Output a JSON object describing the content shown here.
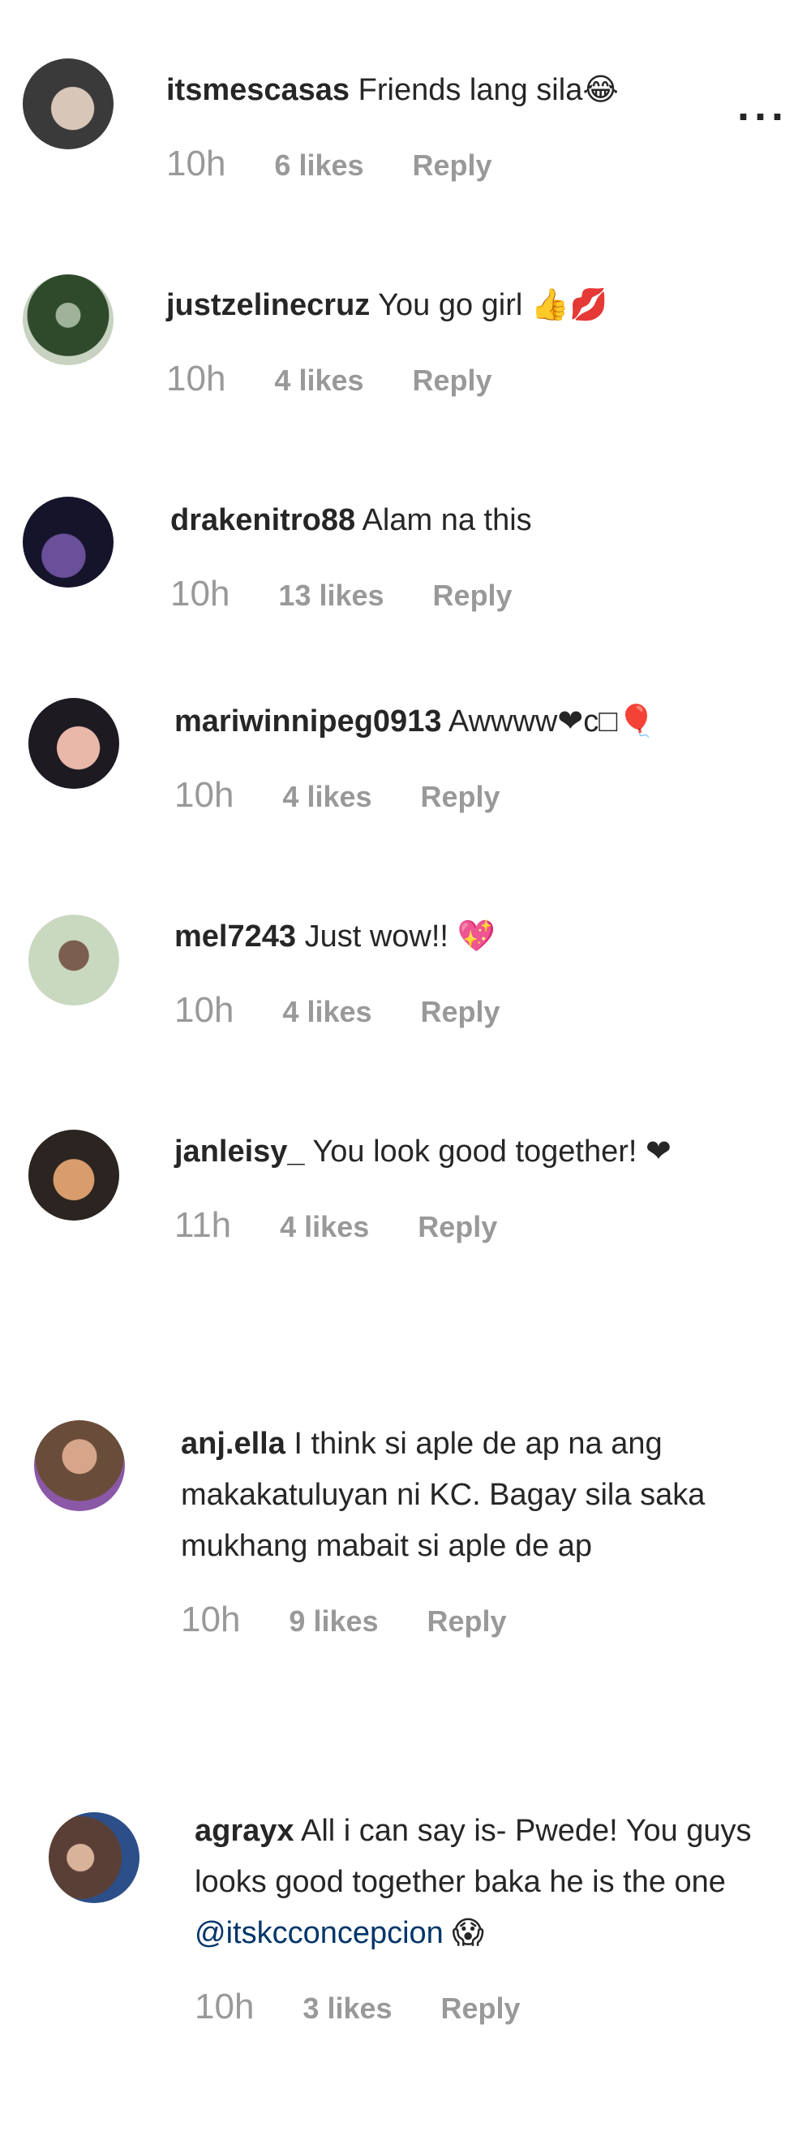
{
  "more_label": "...",
  "comments": [
    {
      "user": "itsmescasas",
      "text": " Friends lang sila😂",
      "time": "10h",
      "likes": "6 likes",
      "reply": "Reply",
      "avatar_colors": [
        "#3a3a3a",
        "#d8c7b8"
      ]
    },
    {
      "user": "justzelinecruz",
      "text": " You go girl 👍💋",
      "time": "10h",
      "likes": "4 likes",
      "reply": "Reply",
      "avatar_colors": [
        "#2f4a2b",
        "#c7d2c0"
      ]
    },
    {
      "user": "drakenitro88",
      "text": " Alam na this",
      "time": "10h",
      "likes": "13 likes",
      "reply": "Reply",
      "avatar_colors": [
        "#16142a",
        "#6a4f9a"
      ]
    },
    {
      "user": "mariwinnipeg0913",
      "text": " Awwww❤c□🎈",
      "time": "10h",
      "likes": "4 likes",
      "reply": "Reply",
      "avatar_colors": [
        "#1d1a22",
        "#e9b8a8"
      ]
    },
    {
      "user": "mel7243",
      "text": " Just wow!! 💖",
      "time": "10h",
      "likes": "4 likes",
      "reply": "Reply",
      "avatar_colors": [
        "#c9d9c0",
        "#7b5e4f"
      ]
    },
    {
      "user": "janleisy_",
      "text": " You look good together! ❤",
      "time": "11h",
      "likes": "4 likes",
      "reply": "Reply",
      "avatar_colors": [
        "#2b2420",
        "#d99c6d"
      ]
    },
    {
      "user": "anj.ella",
      "text": " I think si aple de ap na ang makakatuluyan ni KC. Bagay sila saka mukhang mabait si aple de ap",
      "time": "10h",
      "likes": "9 likes",
      "reply": "Reply",
      "avatar_colors": [
        "#6a4c3a",
        "#8b58a8"
      ]
    },
    {
      "user": "agrayx",
      "text": " All i can say is- Pwede! You guys looks good together baka he is the one ",
      "mention": "@itskcconcepcion",
      "mention_suffix": " 😱",
      "time": "10h",
      "likes": "3 likes",
      "reply": "Reply",
      "avatar_colors": [
        "#5a3f36",
        "#2c4f8a"
      ]
    }
  ]
}
